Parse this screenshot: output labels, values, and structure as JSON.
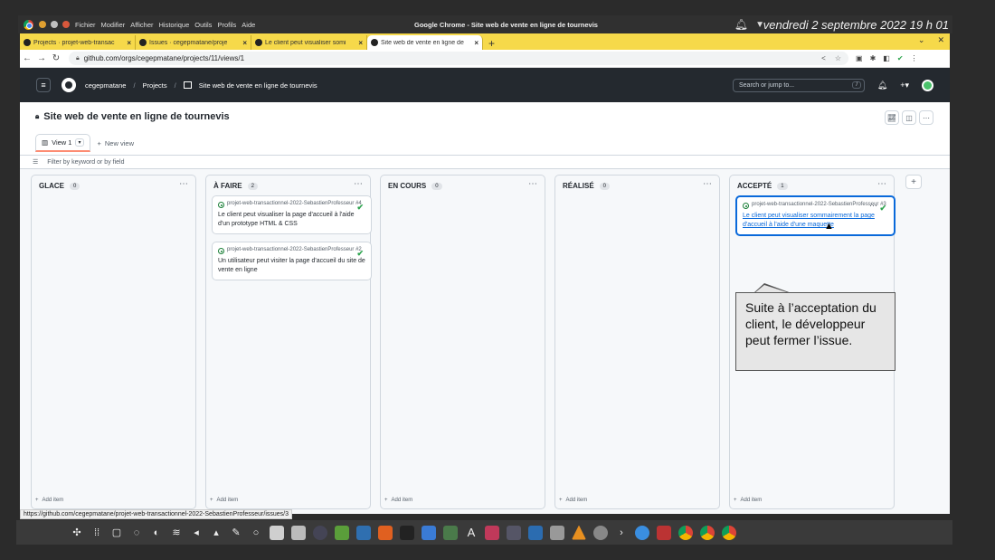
{
  "os": {
    "app_menu": [
      "Fichier",
      "Modifier",
      "Afficher",
      "Historique",
      "Outils",
      "Profils",
      "Aide"
    ],
    "window_title": "Google Chrome - Site web de vente en ligne de tournevis",
    "clock": "vendredi 2 septembre 2022  19 h 01"
  },
  "tabs": [
    {
      "label": "Projects · projet-web-transac",
      "close": "×"
    },
    {
      "label": "Issues · cegepmatane/proje",
      "close": "×"
    },
    {
      "label": "Le client peut visualiser somi",
      "close": "×"
    },
    {
      "label": "Site web de vente en ligne de",
      "close": "×"
    }
  ],
  "address": {
    "url": "github.com/orgs/cegepmatane/projects/11/views/1"
  },
  "header": {
    "org": "cegepmatane",
    "projects": "Projects",
    "project_name": "Site web de vente en ligne de tournevis",
    "search_placeholder": "Search or jump to...",
    "search_key": "/"
  },
  "project": {
    "title": "Site web de vente en ligne de tournevis",
    "view_label": "View 1",
    "new_view": "New view",
    "filter_placeholder": "Filter by keyword or by field"
  },
  "columns": [
    {
      "name": "GLACE",
      "count": "0",
      "add": "Add item",
      "cards": []
    },
    {
      "name": "À FAIRE",
      "count": "2",
      "add": "Add item",
      "cards": [
        {
          "repo": "projet-web-transactionnel-2022-SebastienProfesseur #4",
          "title": "Le client peut visualiser la page d'accueil à l'aide d'un prototype HTML & CSS"
        },
        {
          "repo": "projet-web-transactionnel-2022-SebastienProfesseur #2",
          "title": "Un utilisateur peut visiter la page d'accueil du site de vente en ligne"
        }
      ]
    },
    {
      "name": "EN COURS",
      "count": "0",
      "add": "Add item",
      "cards": []
    },
    {
      "name": "RÉALISÉ",
      "count": "0",
      "add": "Add item",
      "cards": []
    },
    {
      "name": "ACCEPTÉ",
      "count": "1",
      "add": "Add item",
      "cards": [
        {
          "repo": "projet-web-transactionnel-2022-SebastienProfesseur #3",
          "title": "Le client peut visualiser sommairement la page d'accueil à l'aide d'une maquette"
        }
      ]
    }
  ],
  "callout": {
    "text": "Suite à l’acceptation du client, le développeur peut fermer l’issue."
  },
  "status_link": "https://github.com/cegepmatane/projet-web-transactionnel-2022-SebastienProfesseur/issues/3",
  "colors": {
    "tab_strip": "#f6d94a",
    "gh_header": "#24292f",
    "accent_blue": "#0969da",
    "check_green": "#2da44e"
  }
}
